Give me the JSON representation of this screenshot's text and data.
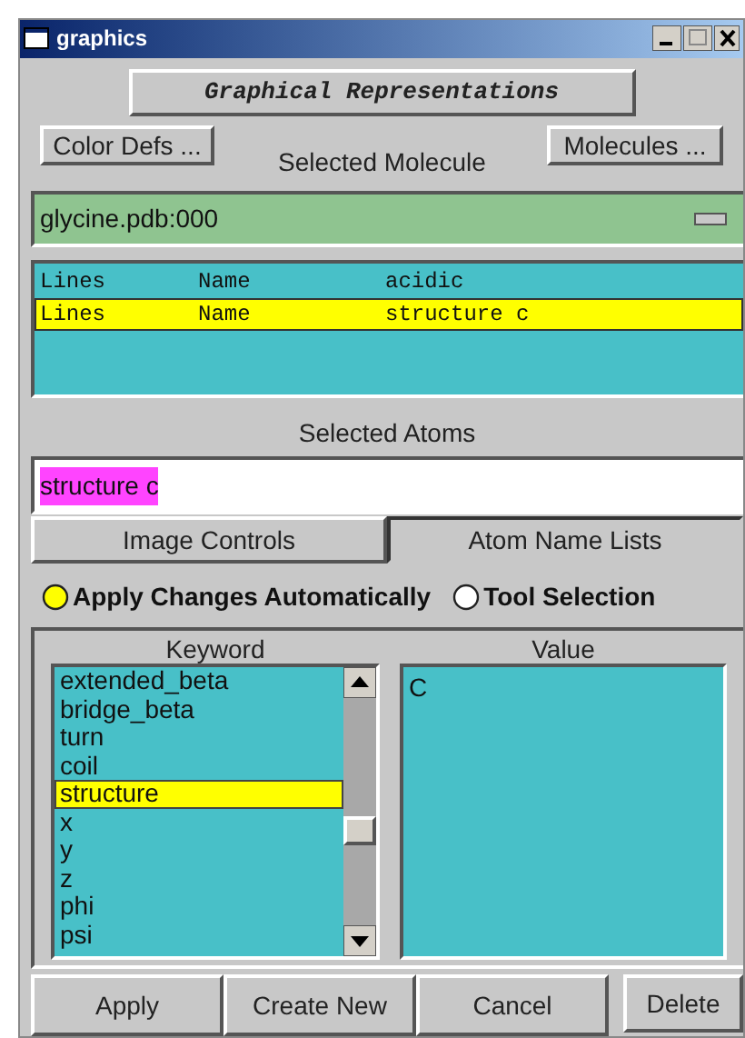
{
  "window": {
    "title": "graphics"
  },
  "header_button": "Graphical Representations",
  "color_defs_button": "Color Defs ...",
  "molecule_label": "Selected Molecule",
  "molecules_button": "Molecules ...",
  "molecule_dropdown": {
    "value": "glycine.pdb:000"
  },
  "representations": [
    {
      "columns": [
        "Lines",
        "Name",
        "acidic"
      ],
      "selected": false
    },
    {
      "columns": [
        "Lines",
        "Name",
        "structure c"
      ],
      "selected": true
    }
  ],
  "atoms_label": "Selected Atoms",
  "atoms_field": {
    "value": "structure c"
  },
  "tabs": [
    {
      "label": "Image Controls",
      "selected": false
    },
    {
      "label": "Atom Name Lists",
      "selected": true
    }
  ],
  "radios": [
    {
      "label": "Apply Changes Automatically",
      "selected": true
    },
    {
      "label": "Tool Selection",
      "selected": false
    }
  ],
  "keyword_label": "Keyword",
  "keywords": [
    {
      "label": "extended_beta",
      "selected": false
    },
    {
      "label": "bridge_beta",
      "selected": false
    },
    {
      "label": "turn",
      "selected": false
    },
    {
      "label": "coil",
      "selected": false
    },
    {
      "label": "structure",
      "selected": true
    },
    {
      "label": "x",
      "selected": false
    },
    {
      "label": "y",
      "selected": false
    },
    {
      "label": "z",
      "selected": false
    },
    {
      "label": "phi",
      "selected": false
    },
    {
      "label": "psi",
      "selected": false
    }
  ],
  "value_label": "Value",
  "values": [
    "C"
  ],
  "buttons": [
    "Apply",
    "Create New",
    "Cancel",
    "Delete"
  ]
}
